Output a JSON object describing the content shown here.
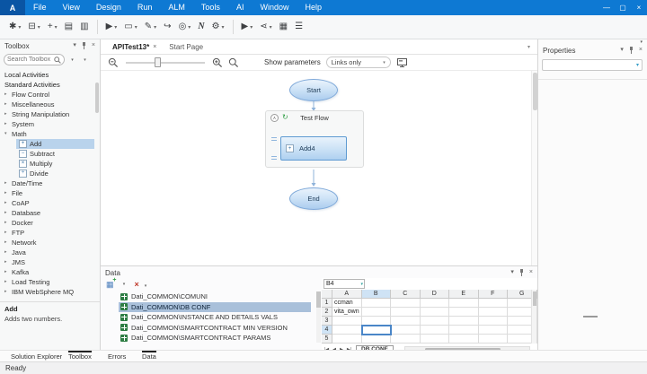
{
  "window": {
    "logo": "A",
    "controls": {
      "minimize": "—",
      "maximize": "▢",
      "close": "×"
    }
  },
  "menu_items": [
    "File",
    "View",
    "Design",
    "Run",
    "ALM",
    "Tools",
    "AI",
    "Window",
    "Help"
  ],
  "icons": {
    "caret": "▾",
    "collapsed": "▸",
    "expanded": "▾",
    "close": "×",
    "panel_menu": "▾",
    "collapse_circle": "∧",
    "refresh": "↻",
    "plus": "+",
    "delete": "×",
    "nav_first": "|◀",
    "nav_prev": "◀",
    "nav_next": "▶",
    "nav_last": "▶|"
  },
  "toolbar": {
    "buttons": [
      {
        "name": "new",
        "glyph": "✱"
      },
      {
        "name": "save",
        "glyph": "⊟"
      },
      {
        "name": "add",
        "glyph": "+"
      },
      {
        "name": "paste",
        "glyph": "▤"
      },
      {
        "name": "copy",
        "glyph": "▥"
      },
      {
        "name": "run",
        "glyph": "▶"
      },
      {
        "name": "container",
        "glyph": "▭"
      },
      {
        "name": "edit",
        "glyph": "✎"
      },
      {
        "name": "redo",
        "glyph": "↪"
      },
      {
        "name": "record",
        "glyph": "◎"
      },
      {
        "name": "note",
        "glyph": "N"
      },
      {
        "name": "settings",
        "glyph": "⚙"
      },
      {
        "name": "step",
        "glyph": "▶"
      },
      {
        "name": "share",
        "glyph": "⋖"
      },
      {
        "name": "report",
        "glyph": "▦"
      },
      {
        "name": "options",
        "glyph": "☰"
      }
    ]
  },
  "toolbox": {
    "title": "Toolbox",
    "search_placeholder": "Search Toolbox",
    "items": [
      {
        "label": "Local Activities"
      },
      {
        "label": "Standard Activities"
      },
      {
        "label": "Flow Control"
      },
      {
        "label": "Miscellaneous"
      },
      {
        "label": "String Manipulation"
      },
      {
        "label": "System"
      },
      {
        "label": "Math"
      },
      {
        "label": "Add",
        "op": "+",
        "selected": true
      },
      {
        "label": "Subtract",
        "op": "−"
      },
      {
        "label": "Multiply",
        "op": "×"
      },
      {
        "label": "Divide",
        "op": "÷"
      },
      {
        "label": "Date/Time"
      },
      {
        "label": "File"
      },
      {
        "label": "CoAP"
      },
      {
        "label": "Database"
      },
      {
        "label": "Docker"
      },
      {
        "label": "FTP"
      },
      {
        "label": "Network"
      },
      {
        "label": "Java"
      },
      {
        "label": "JMS"
      },
      {
        "label": "Kafka"
      },
      {
        "label": "Load Testing"
      },
      {
        "label": "IBM WebSphere MQ"
      }
    ],
    "description": {
      "title": "Add",
      "text": "Adds two numbers."
    }
  },
  "editor": {
    "tabs": [
      {
        "label": "APITest13*",
        "active": true
      },
      {
        "label": "Start Page"
      }
    ],
    "toolbar": {
      "show_parameters_label": "Show parameters",
      "parameters_value": "Links only"
    },
    "flow": {
      "start_label": "Start",
      "container_label": "Test Flow",
      "activity_label": "Add4",
      "end_label": "End"
    }
  },
  "data_panel": {
    "title": "Data",
    "items": [
      {
        "label": "Dati_COMMON\\COMUNI"
      },
      {
        "label": "Dati_COMMON\\DB CONF",
        "selected": true
      },
      {
        "label": "Dati_COMMON\\INSTANCE AND DETAILS VALS"
      },
      {
        "label": "Dati_COMMON\\SMARTCONTRACT MIN VERSION"
      },
      {
        "label": "Dati_COMMON\\SMARTCONTRACT PARAMS"
      }
    ],
    "spreadsheet": {
      "name_box": "B4",
      "columns": [
        "A",
        "B",
        "C",
        "D",
        "E",
        "F",
        "G"
      ],
      "rows": [
        "1",
        "2",
        "3",
        "4",
        "5"
      ],
      "cells": {
        "A1": "ccman",
        "A2": "vita_own"
      },
      "selected_cell": "B4",
      "sheet_tab": "DB CONF"
    }
  },
  "dock_tabs": {
    "left": [
      {
        "label": "Solution Explorer"
      },
      {
        "label": "Toolbox",
        "active": true
      }
    ],
    "center": [
      {
        "label": "Errors"
      },
      {
        "label": "Data",
        "active": true
      }
    ]
  },
  "properties_panel": {
    "title": "Properties",
    "combo_value": ""
  },
  "status_bar": {
    "text": "Ready"
  }
}
